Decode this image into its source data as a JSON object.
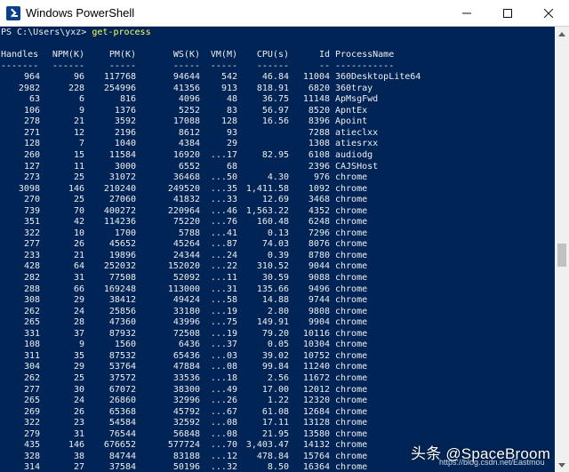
{
  "window": {
    "title": "Windows PowerShell",
    "minimize_icon": "minimize-icon",
    "maximize_icon": "maximize-icon",
    "close_icon": "close-icon"
  },
  "console": {
    "prompt": "PS C:\\Users\\yxz> ",
    "command": "get-process",
    "headers": [
      "Handles",
      "NPM(K)",
      "PM(K)",
      "WS(K)",
      "VM(M)",
      "CPU(s)",
      "Id",
      "ProcessName"
    ],
    "separators": [
      "-------",
      "------",
      "-----",
      "-----",
      "-----",
      "------",
      "--",
      "-----------"
    ],
    "rows": [
      [
        "964",
        "96",
        "117768",
        "94644",
        "542",
        "46.84",
        "11004",
        "360DesktopLite64"
      ],
      [
        "2982",
        "228",
        "254996",
        "41356",
        "913",
        "818.91",
        "6820",
        "360tray"
      ],
      [
        "63",
        "6",
        "816",
        "4096",
        "48",
        "36.75",
        "11148",
        "ApMsgFwd"
      ],
      [
        "106",
        "9",
        "1376",
        "5252",
        "83",
        "56.97",
        "8520",
        "ApntEx"
      ],
      [
        "278",
        "21",
        "3592",
        "17088",
        "128",
        "16.56",
        "8396",
        "Apoint"
      ],
      [
        "271",
        "12",
        "2196",
        "8612",
        "93",
        "",
        "7288",
        "atieclxx"
      ],
      [
        "128",
        "7",
        "1040",
        "4384",
        "29",
        "",
        "1308",
        "atiesrxx"
      ],
      [
        "260",
        "15",
        "11584",
        "16920",
        "...17",
        "82.95",
        "6108",
        "audiodg"
      ],
      [
        "127",
        "11",
        "3000",
        "6552",
        "68",
        "",
        "2396",
        "CAJSHost"
      ],
      [
        "273",
        "25",
        "31072",
        "36468",
        "...50",
        "4.30",
        "976",
        "chrome"
      ],
      [
        "3098",
        "146",
        "210240",
        "249520",
        "...35",
        "1,411.58",
        "1092",
        "chrome"
      ],
      [
        "270",
        "25",
        "27060",
        "41832",
        "...33",
        "12.69",
        "3468",
        "chrome"
      ],
      [
        "739",
        "70",
        "400272",
        "220964",
        "...46",
        "1,563.22",
        "4352",
        "chrome"
      ],
      [
        "351",
        "42",
        "114236",
        "75220",
        "...76",
        "160.48",
        "6248",
        "chrome"
      ],
      [
        "322",
        "10",
        "1700",
        "5788",
        "...41",
        "0.13",
        "7296",
        "chrome"
      ],
      [
        "277",
        "26",
        "45652",
        "45264",
        "...87",
        "74.03",
        "8076",
        "chrome"
      ],
      [
        "233",
        "21",
        "19896",
        "24344",
        "...24",
        "0.39",
        "8780",
        "chrome"
      ],
      [
        "428",
        "64",
        "252032",
        "152020",
        "...22",
        "310.52",
        "9044",
        "chrome"
      ],
      [
        "282",
        "31",
        "77508",
        "52092",
        "...11",
        "30.59",
        "9088",
        "chrome"
      ],
      [
        "288",
        "66",
        "169248",
        "113000",
        "...31",
        "135.66",
        "9496",
        "chrome"
      ],
      [
        "308",
        "29",
        "38412",
        "49424",
        "...58",
        "14.88",
        "9744",
        "chrome"
      ],
      [
        "262",
        "24",
        "25856",
        "33180",
        "...19",
        "2.80",
        "9808",
        "chrome"
      ],
      [
        "265",
        "28",
        "47360",
        "43996",
        "...75",
        "149.91",
        "9904",
        "chrome"
      ],
      [
        "331",
        "37",
        "87932",
        "72508",
        "...19",
        "79.20",
        "10116",
        "chrome"
      ],
      [
        "108",
        "9",
        "1560",
        "6436",
        "...37",
        "0.05",
        "10304",
        "chrome"
      ],
      [
        "311",
        "35",
        "87532",
        "65436",
        "...03",
        "39.02",
        "10752",
        "chrome"
      ],
      [
        "304",
        "29",
        "53764",
        "47884",
        "...08",
        "99.84",
        "11240",
        "chrome"
      ],
      [
        "262",
        "25",
        "37572",
        "33536",
        "...18",
        "2.56",
        "11672",
        "chrome"
      ],
      [
        "277",
        "30",
        "67072",
        "38300",
        "...49",
        "17.00",
        "12012",
        "chrome"
      ],
      [
        "265",
        "24",
        "26860",
        "32996",
        "...26",
        "1.22",
        "12320",
        "chrome"
      ],
      [
        "269",
        "26",
        "65368",
        "45792",
        "...67",
        "61.08",
        "12684",
        "chrome"
      ],
      [
        "322",
        "23",
        "54584",
        "32592",
        "...08",
        "17.11",
        "13128",
        "chrome"
      ],
      [
        "279",
        "31",
        "76544",
        "56848",
        "...08",
        "21.95",
        "13580",
        "chrome"
      ],
      [
        "435",
        "146",
        "676652",
        "577724",
        "...70",
        "3,403.47",
        "14132",
        "chrome"
      ],
      [
        "328",
        "38",
        "84744",
        "83188",
        "...12",
        "478.84",
        "15764",
        "chrome"
      ],
      [
        "314",
        "27",
        "37584",
        "50196",
        "...32",
        "8.50",
        "16364",
        "chrome"
      ]
    ]
  },
  "scrollbar": {
    "up_icon": "scroll-up-arrow-icon",
    "down_icon": "scroll-down-arrow-icon"
  },
  "watermark": {
    "text": "头条 @SpaceBroom",
    "url": "https://blog.csdn.net/Eastmou"
  }
}
